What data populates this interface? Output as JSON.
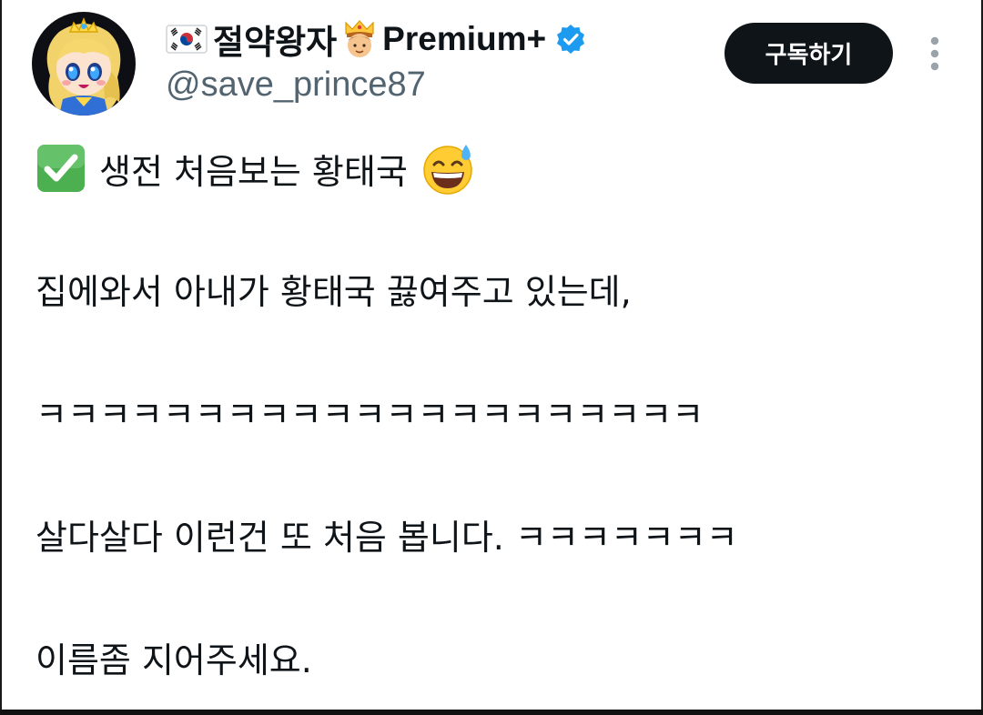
{
  "author": {
    "display_name": "절약왕자",
    "premium_label": "Premium+",
    "handle": "@save_prince87",
    "avatar_icon": "cartoon-princess-avatar",
    "flag_icon": "south-korea-flag",
    "crown_icon": "prince-crown-emoji",
    "verified_icon": "verified-badge",
    "verified_color": "#1d9bf0"
  },
  "actions": {
    "subscribe_label": "구독하기",
    "subscribe_bg": "#0f1419",
    "more_icon": "vertical-dots-icon"
  },
  "post": {
    "line1": "생전 처음보는 황태국",
    "line1_prefix_icon": "check-mark-button-emoji",
    "line1_suffix_icon": "grinning-sweat-emoji",
    "line2": "집에와서 아내가 황태국 끓여주고 있는데,",
    "line3": "ㅋㅋㅋㅋㅋㅋㅋㅋㅋㅋㅋㅋㅋㅋㅋㅋㅋㅋㅋㅋㅋ",
    "line4": "살다살다 이런건 또 처음 봅니다. ㅋㅋㅋㅋㅋㅋㅋ",
    "line5": "이름좀 지어주세요."
  }
}
